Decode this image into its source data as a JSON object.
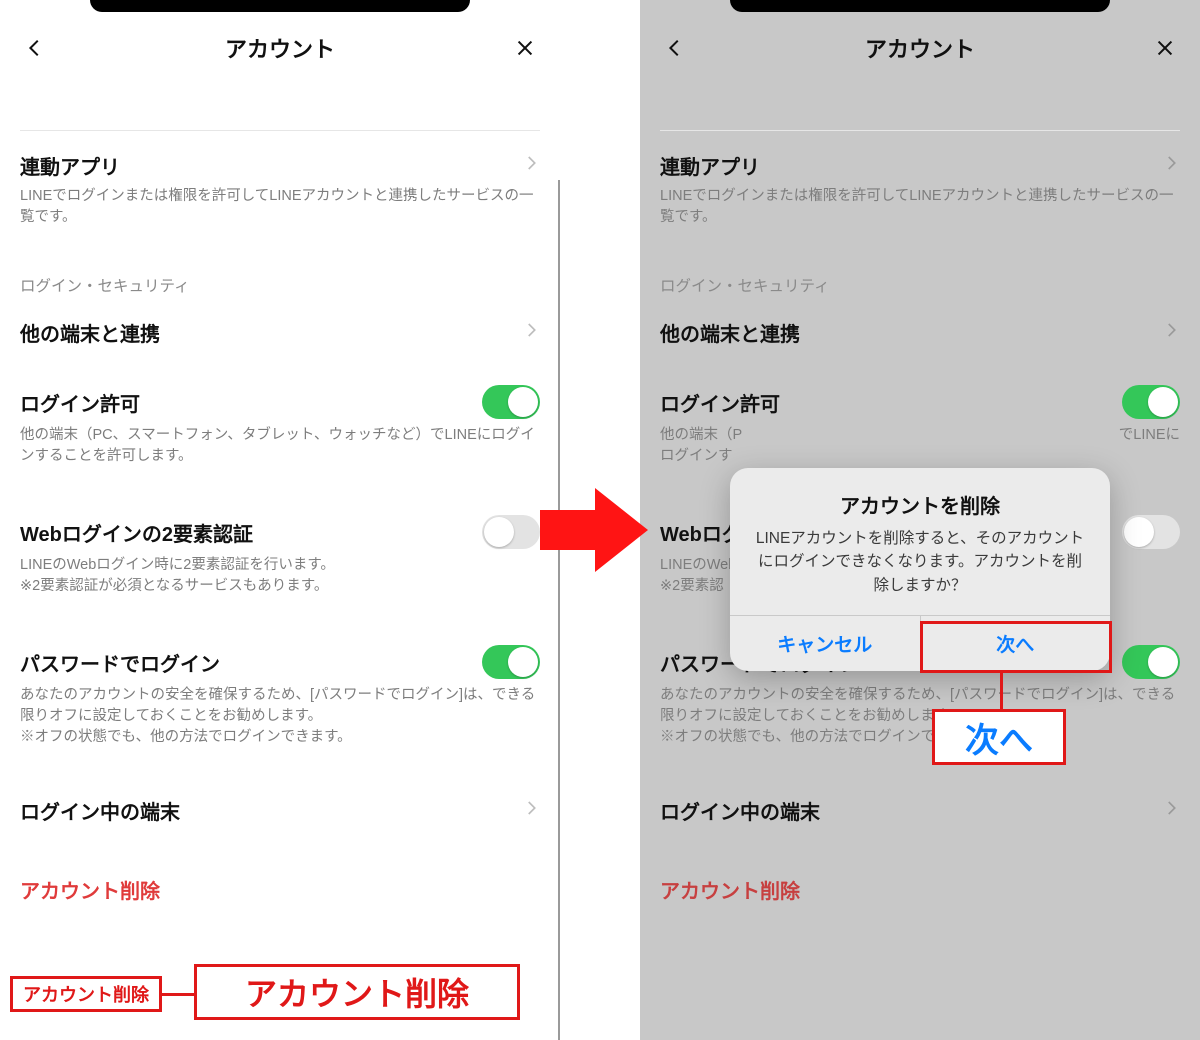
{
  "header": {
    "title": "アカウント"
  },
  "rows": {
    "linked_apps": {
      "title": "連動アプリ",
      "desc": "LINEでログインまたは権限を許可してLINEアカウントと連携したサービスの一覧です。"
    },
    "group_label": "ログイン・セキュリティ",
    "other_devices": {
      "title": "他の端末と連携"
    },
    "login_allow": {
      "title": "ログイン許可",
      "desc": "他の端末（PC、スマートフォン、タブレット、ウォッチなど）でLINEにログインすることを許可します。"
    },
    "web_2fa": {
      "title": "Webログインの2要素認証",
      "desc": "LINEのWebログイン時に2要素認証を行います。\n※2要素認証が必須となるサービスもあります。"
    },
    "password_login": {
      "title": "パスワードでログイン",
      "desc": "あなたのアカウントの安全を確保するため、[パスワードでログイン]は、できる限りオフに設定しておくことをお勧めします。\n※オフの状態でも、他の方法でログインできます。"
    },
    "logged_in_devices": {
      "title": "ログイン中の端末"
    },
    "delete_account": {
      "title": "アカウント削除"
    }
  },
  "right_partial": {
    "login_allow_desc_left": "他の端末（P",
    "login_allow_desc_right": "でLINEに",
    "login_allow_desc_line2": "ログインす",
    "web_2fa_title_left": "Webログ",
    "web_2fa_desc1": "LINEのWeb",
    "web_2fa_desc2": "※2要素認"
  },
  "alert": {
    "title": "アカウントを削除",
    "message": "LINEアカウントを削除すると、そのアカウントにログインできなくなります。アカウントを削除しますか？",
    "cancel": "キャンセル",
    "next": "次へ"
  },
  "annotations": {
    "delete_small": "アカウント削除",
    "delete_big": "アカウント削除",
    "next_big": "次へ"
  }
}
